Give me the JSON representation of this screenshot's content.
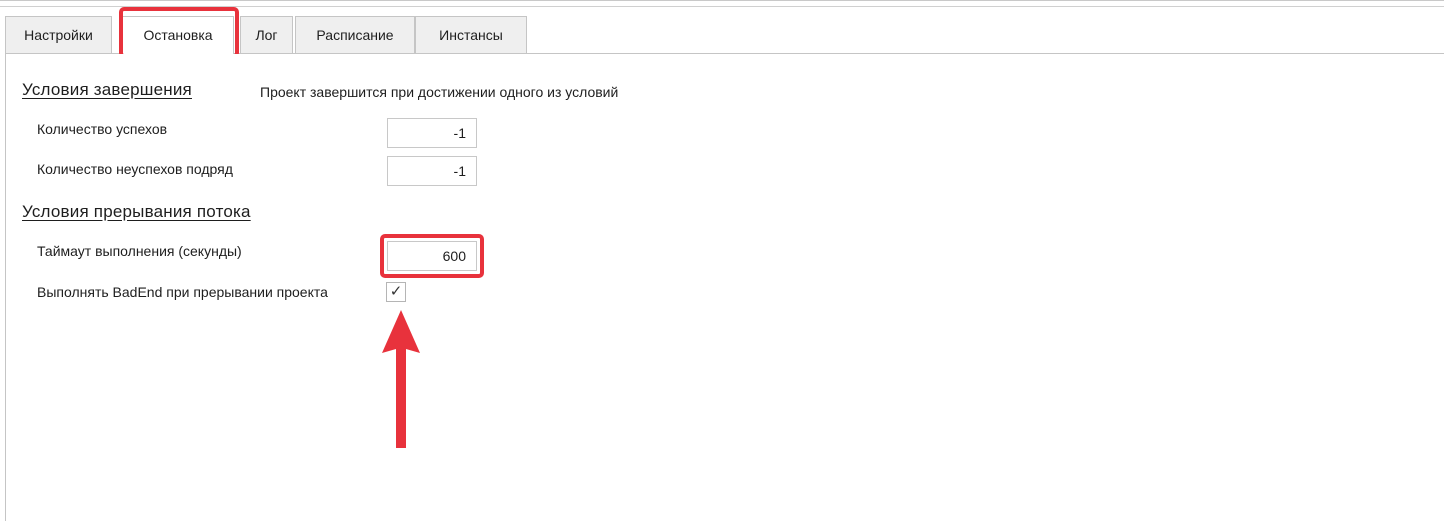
{
  "tabs": [
    {
      "label": "Настройки",
      "active": false
    },
    {
      "label": "Остановка",
      "active": true
    },
    {
      "label": "Лог",
      "active": false
    },
    {
      "label": "Расписание",
      "active": false
    },
    {
      "label": "Инстансы",
      "active": false
    }
  ],
  "completion": {
    "title": "Условия завершения",
    "description": "Проект завершится при достижении одного из условий",
    "success_count_label": "Количество успехов",
    "success_count_value": "-1",
    "fail_streak_label": "Количество неуспехов подряд",
    "fail_streak_value": "-1"
  },
  "interrupt": {
    "title": "Условия прерывания потока",
    "timeout_label": "Таймаут выполнения (секунды)",
    "timeout_value": "600",
    "badend_label": "Выполнять BadEnd при прерывании проекта",
    "badend_checked": true,
    "badend_check_glyph": "✓"
  },
  "colors": {
    "highlight": "#e8323c",
    "tab_inactive_bg": "#efefef",
    "border": "#c5c5c5"
  },
  "icons": {
    "annotation_arrow": "up-arrow-icon",
    "checkmark": "checkmark-icon"
  }
}
